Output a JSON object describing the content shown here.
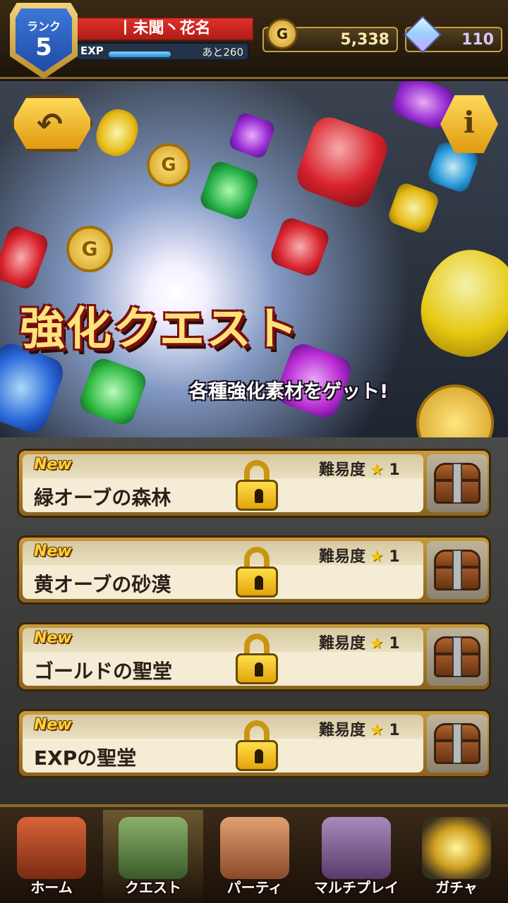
{
  "header": {
    "rank_label": "ランク",
    "rank_value": "5",
    "player_name": "丨未聞丶花名",
    "exp_label": "EXP",
    "exp_fraction": 0.55,
    "exp_remaining": "あと260",
    "gold_symbol": "G",
    "gold": "5,338",
    "gems": "110"
  },
  "banner": {
    "title": "強化クエスト",
    "subtitle": "各種強化素材をゲット!",
    "back_icon": "back-arrow-icon",
    "info_glyph": "i"
  },
  "quests": [
    {
      "badge": "New",
      "difficulty_label": "難易度",
      "star": "★",
      "difficulty": "1",
      "name": "緑オーブの森林",
      "locked": true
    },
    {
      "badge": "New",
      "difficulty_label": "難易度",
      "star": "★",
      "difficulty": "1",
      "name": "黄オーブの砂漠",
      "locked": true
    },
    {
      "badge": "New",
      "difficulty_label": "難易度",
      "star": "★",
      "difficulty": "1",
      "name": "ゴールドの聖堂",
      "locked": true
    },
    {
      "badge": "New",
      "difficulty_label": "難易度",
      "star": "★",
      "difficulty": "1",
      "name": "EXPの聖堂",
      "locked": true
    }
  ],
  "nav": [
    {
      "label": "ホーム",
      "icon": "house-icon",
      "color": "#b84a2a"
    },
    {
      "label": "クエスト",
      "icon": "warrior-icon",
      "color": "#6a8a4a",
      "active": true
    },
    {
      "label": "パーティ",
      "icon": "party-icon",
      "color": "#c98a5a"
    },
    {
      "label": "マルチプレイ",
      "icon": "multiplayer-icon",
      "color": "#8a6a9a"
    },
    {
      "label": "ガチャ",
      "icon": "gacha-icon",
      "color": "#4a4030"
    }
  ],
  "colors": {
    "accent_gold": "#e0a820",
    "rank_blue": "#1f4aa8",
    "name_red": "#c82420"
  }
}
